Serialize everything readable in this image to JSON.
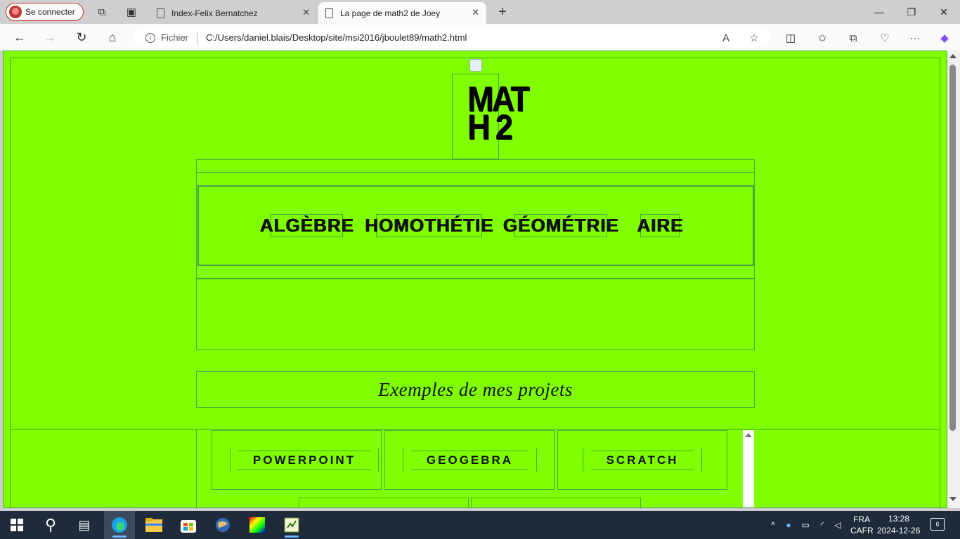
{
  "browser": {
    "profile_label": "Se connecter",
    "tabs": [
      {
        "label": "Index-Felix Bernatchez",
        "active": false
      },
      {
        "label": "La page de math2 de Joey",
        "active": true
      }
    ],
    "address": {
      "scheme_label": "Fichier",
      "url": "C:/Users/daniel.blais/Desktop/site/msi2016/jboulet89/math2.html"
    }
  },
  "page": {
    "heading": "MATH 2",
    "nav_links": [
      "ALGÈBRE",
      "HOMOTHÉTIE",
      "GÉOMÉTRIE",
      "AIRE"
    ],
    "projects_title": "Exemples de mes projets",
    "project_buttons": [
      "POWERPOINT",
      "GEOGEBRA",
      "SCRATCH"
    ]
  },
  "taskbar": {
    "language": "FRA",
    "layout": "CAFR",
    "time": "13:28",
    "date": "2024-12-26",
    "notifications": "6"
  },
  "colors": {
    "page_background": "#80ff00",
    "border_green": "#3fae3f",
    "taskbar": "#1f2b3a"
  }
}
